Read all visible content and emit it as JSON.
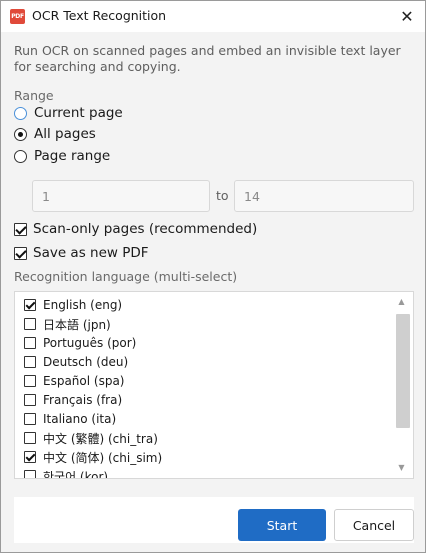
{
  "titlebar": {
    "app_icon_text": "PDF",
    "title": "OCR Text Recognition",
    "close_glyph": "✕"
  },
  "description": "Run OCR on scanned pages and embed an invisible text layer for searching and copying.",
  "range": {
    "label": "Range",
    "options": [
      {
        "label": "Current page",
        "checked": false
      },
      {
        "label": "All pages",
        "checked": true
      },
      {
        "label": "Page range",
        "checked": false
      }
    ],
    "from_value": "1",
    "to_label": "to",
    "to_value": "14"
  },
  "options": {
    "scan_only": {
      "label": "Scan-only pages (recommended)",
      "checked": true
    },
    "save_new": {
      "label": "Save as new PDF",
      "checked": true
    }
  },
  "languages": {
    "label": "Recognition language (multi-select)",
    "items": [
      {
        "label": "English (eng)",
        "checked": true
      },
      {
        "label": "日本語 (jpn)",
        "checked": false
      },
      {
        "label": "Português (por)",
        "checked": false
      },
      {
        "label": "Deutsch (deu)",
        "checked": false
      },
      {
        "label": "Español (spa)",
        "checked": false
      },
      {
        "label": "Français (fra)",
        "checked": false
      },
      {
        "label": "Italiano (ita)",
        "checked": false
      },
      {
        "label": "中文 (繁體) (chi_tra)",
        "checked": false
      },
      {
        "label": "中文 (简体) (chi_sim)",
        "checked": true
      },
      {
        "label": "한국어 (kor)",
        "checked": false
      }
    ]
  },
  "buttons": {
    "start": "Start",
    "cancel": "Cancel"
  },
  "colors": {
    "accent": "#1f6cc5",
    "app_icon": "#e04a3a"
  }
}
